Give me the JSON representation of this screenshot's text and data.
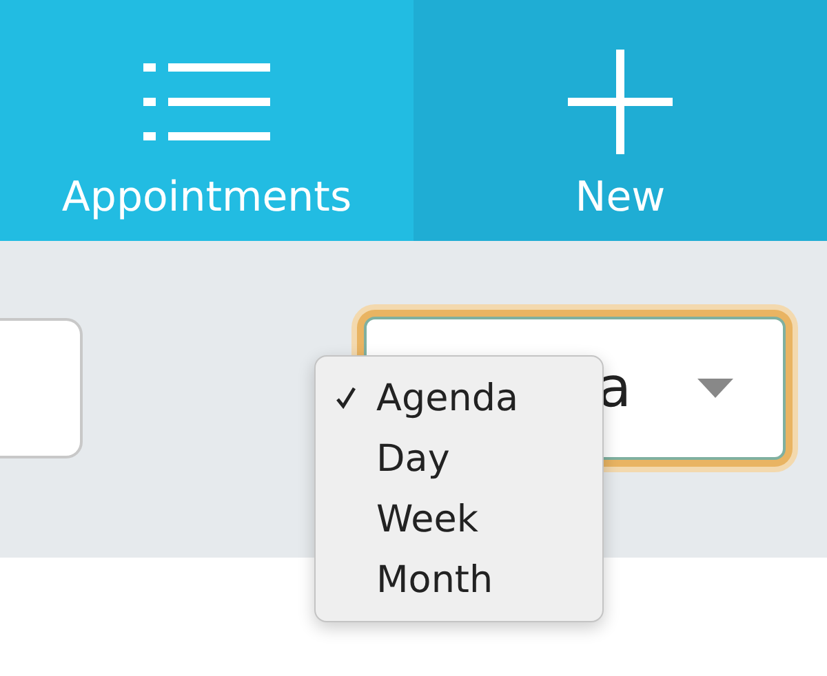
{
  "tabs": [
    {
      "label": "Appointments",
      "kind": "list",
      "selected": true
    },
    {
      "label": "New",
      "kind": "plus",
      "selected": false
    }
  ],
  "view_select": {
    "visible_value": "a",
    "focused": true
  },
  "view_menu": {
    "items": [
      {
        "label": "Agenda",
        "selected": true
      },
      {
        "label": "Day",
        "selected": false
      },
      {
        "label": "Week",
        "selected": false
      },
      {
        "label": "Month",
        "selected": false
      }
    ]
  }
}
